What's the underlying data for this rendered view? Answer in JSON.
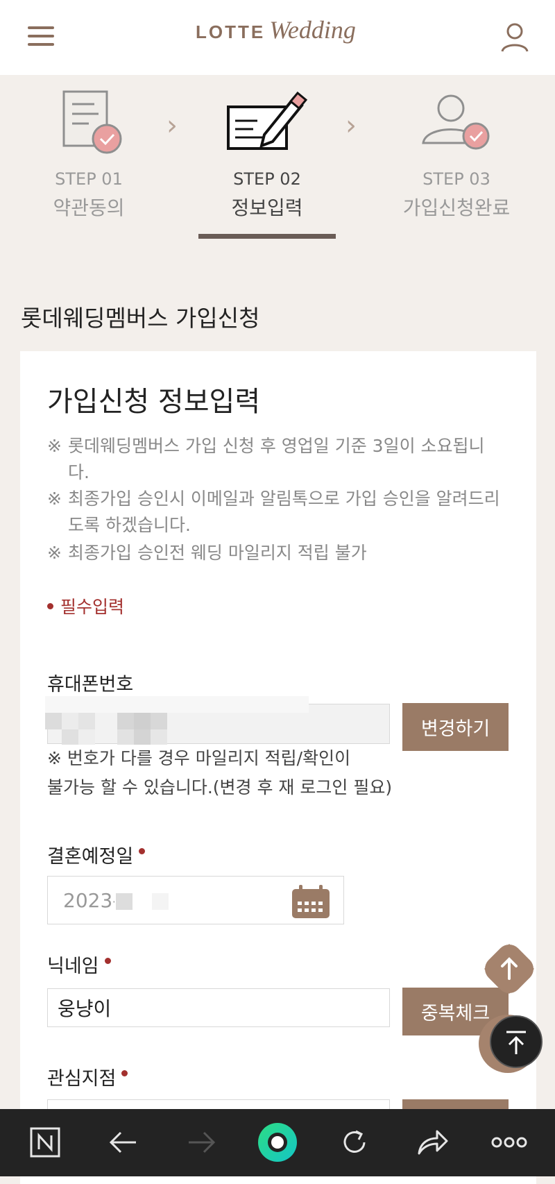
{
  "header": {
    "logo_main": "LOTTE",
    "logo_script": "Wedding"
  },
  "steps": [
    {
      "num": "STEP 01",
      "label": "약관동의"
    },
    {
      "num": "STEP 02",
      "label": "정보입력"
    },
    {
      "num": "STEP 03",
      "label": "가입신청완료"
    }
  ],
  "section_title": "롯데웨딩멤버스 가입신청",
  "form": {
    "title": "가입신청 정보입력",
    "notices": [
      "롯데웨딩멤버스 가입 신청 후 영업일 기준 3일이 소요됩니다.",
      "최종가입 승인시 이메일과 알림톡으로 가입 승인을 알려드리도록 하겠습니다.",
      "최종가입 승인전 웨딩 마일리지 적립 불가"
    ],
    "notice_mark": "※",
    "required_label": "필수입력",
    "phone": {
      "label": "휴대폰번호",
      "change_button": "변경하기",
      "note_line1": "※ 번호가 다를 경우 마일리지 적립/확인이",
      "note_line2": "불가능 할 수 있습니다.(변경 후 재 로그인 필요)"
    },
    "wedding_date": {
      "label": "결혼예정일",
      "value_prefix": "2023-"
    },
    "nickname": {
      "label": "닉네임",
      "value": "웅냥이",
      "check_button": "중복체크"
    },
    "branch": {
      "label": "관심지점"
    }
  },
  "colors": {
    "brand_brown": "#9a7b66",
    "required_red": "#a3302e",
    "page_bg": "#f3efeb"
  }
}
